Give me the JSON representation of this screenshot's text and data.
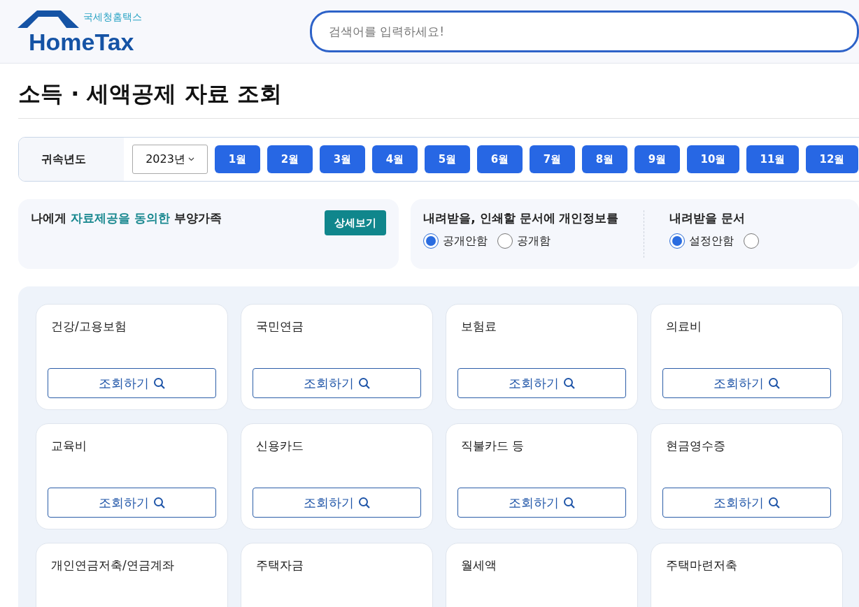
{
  "header": {
    "logo": {
      "small": "국세청홈택스",
      "big": "HomeTax"
    },
    "search": {
      "placeholder": "검색어를 입력하세요!"
    }
  },
  "title": "소득 · 세액공제 자료 조회",
  "year_bar": {
    "label": "귀속년도",
    "year": "2023년",
    "months": [
      "1월",
      "2월",
      "3월",
      "4월",
      "5월",
      "6월",
      "7월",
      "8월",
      "9월",
      "10월",
      "11월",
      "12월"
    ]
  },
  "consent_panel": {
    "title": [
      {
        "text": "나에게 ",
        "highlight": false
      },
      {
        "text": "자료제공을 동의한",
        "highlight": true
      },
      {
        "text": " 부양가족",
        "highlight": false
      }
    ],
    "button": "상세보기"
  },
  "settings_panel": [
    {
      "title": "내려받을, 인쇄할 문서에 개인정보를",
      "options": [
        {
          "label": "공개안함",
          "selected": true
        },
        {
          "label": "공개함",
          "selected": false
        }
      ]
    },
    {
      "title": "내려받을 문서",
      "options": [
        {
          "label": "설정안함",
          "selected": true
        },
        {
          "selected": false
        }
      ]
    }
  ],
  "cards": [
    {
      "title": "건강/고용보험",
      "button": "조회하기"
    },
    {
      "title": "국민연금",
      "button": "조회하기"
    },
    {
      "title": "보험료",
      "button": "조회하기"
    },
    {
      "title": "의료비",
      "button": "조회하기"
    },
    {
      "title": "교육비",
      "button": "조회하기"
    },
    {
      "title": "신용카드",
      "button": "조회하기"
    },
    {
      "title": "직불카드 등",
      "button": "조회하기"
    },
    {
      "title": "현금영수증",
      "button": "조회하기"
    },
    {
      "title": "개인연금저축/연금계좌"
    },
    {
      "title": "주택자금"
    },
    {
      "title": "월세액"
    },
    {
      "title": "주택마련저축"
    }
  ]
}
